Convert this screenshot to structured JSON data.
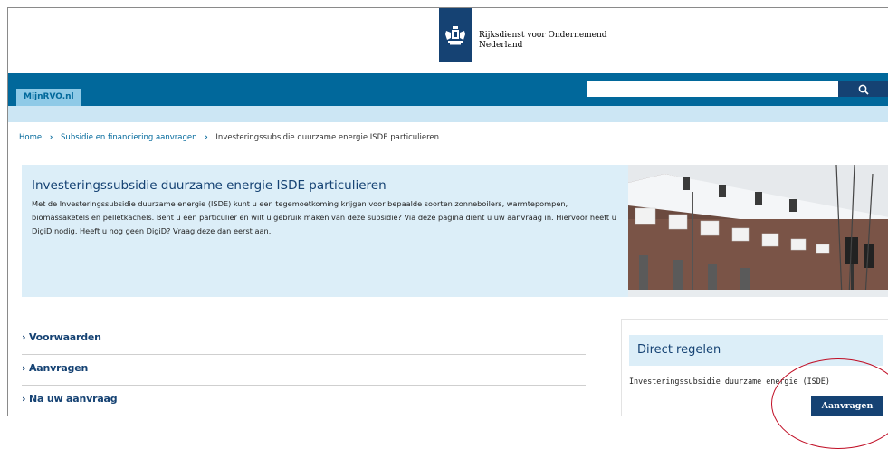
{
  "header": {
    "logo_line1": "Rijksdienst voor Ondernemend",
    "logo_line2": "Nederland"
  },
  "nav": {
    "tab_label": "MijnRVO.nl",
    "search_placeholder": ""
  },
  "breadcrumb": {
    "items": [
      "Home",
      "Subsidie en financiering aanvragen",
      "Investeringssubsidie duurzame energie ISDE particulieren"
    ]
  },
  "hero": {
    "title": "Investeringssubsidie duurzame energie ISDE particulieren",
    "body": "Met de Investeringssubsidie duurzame energie (ISDE) kunt u een tegemoetkoming krijgen voor bepaalde soorten zonneboilers, warmtepompen, biomassaketels en pelletkachels. Bent u een particulier en wilt u gebruik maken van deze subsidie? Via deze pagina dient u uw aanvraag in. Hiervoor heeft u DigiD nodig. Heeft u nog geen DigiD? Vraag deze dan eerst aan."
  },
  "accordion": {
    "items": [
      "› Voorwaarden",
      "› Aanvragen",
      "› Na uw aanvraag"
    ]
  },
  "direct": {
    "title": "Direct regelen",
    "item_text": "Investeringssubsidie duurzame energie (ISDE)",
    "button_label": "Aanvragen"
  },
  "colors": {
    "brand_dark": "#154273",
    "brand_blue": "#01689b",
    "light_blue": "#dceef8",
    "annotation_red": "#c00d24"
  }
}
